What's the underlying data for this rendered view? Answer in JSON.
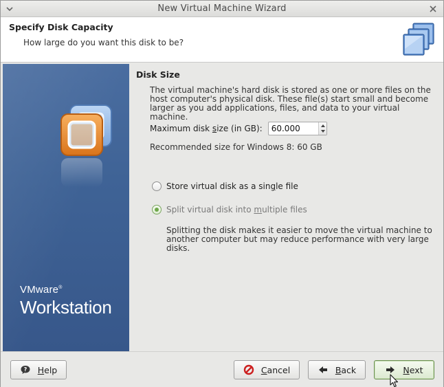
{
  "window": {
    "title": "New Virtual Machine Wizard"
  },
  "header": {
    "title": "Specify Disk Capacity",
    "subtitle": "How large do you want this disk to be?"
  },
  "banner": {
    "brand_line1": "VMware",
    "brand_mark": "®",
    "brand_line2": "Workstation"
  },
  "disk_size": {
    "section_title": "Disk Size",
    "description": "The virtual machine's hard disk is stored as one or more files on the host computer's physical disk. These file(s) start small and become larger as you add applications, files, and data to your virtual machine.",
    "max_label_before": "Maximum disk ",
    "max_label_underlined": "s",
    "max_label_after": "ize (in GB):",
    "max_value": "60.000",
    "recommended": "Recommended size for Windows 8: 60 GB"
  },
  "options": {
    "single_before": "Store virtual disk as a sin",
    "single_underlined": "g",
    "single_after": "le file",
    "single_checked": false,
    "multi_before": "Split virtual disk into ",
    "multi_underlined": "m",
    "multi_after": "ultiple files",
    "multi_checked": true,
    "split_description": "Splitting the disk makes it easier to move the virtual machine to another computer but may reduce performance with very large disks."
  },
  "footer": {
    "help_underlined": "H",
    "help_rest": "elp",
    "cancel_underlined": "C",
    "cancel_rest": "ancel",
    "back_underlined": "B",
    "back_rest": "ack",
    "next_underlined": "N",
    "next_rest": "ext"
  },
  "colors": {
    "banner_blue": "#3f6396",
    "logo_orange": "#e98a2a",
    "accent_green": "#6fa74b"
  },
  "icons": {
    "menu": "menu-icon",
    "close": "close-icon",
    "header": "vm-stack-icon",
    "help": "help-icon",
    "cancel": "cancel-icon",
    "back": "arrow-left-icon",
    "next": "arrow-right-icon",
    "cursor": "mouse-cursor-icon"
  }
}
